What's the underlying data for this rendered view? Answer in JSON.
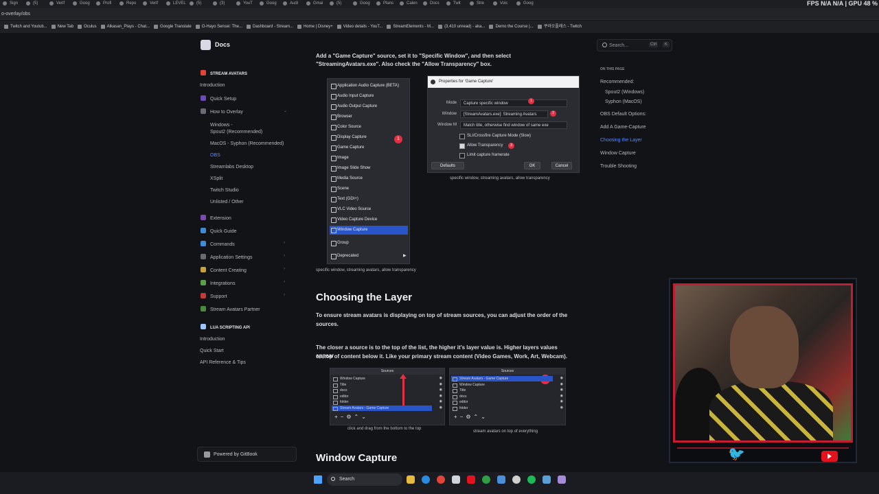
{
  "perf": "FPS N/A N/A | GPU 48 %",
  "browser": {
    "url": "o-overlay/obs",
    "tabs": [
      "Sign",
      "(5)",
      "Verif",
      "Goog",
      "Profi",
      "Repo",
      "Verif",
      "LEVEL",
      "(5)",
      "(3)",
      "YouT",
      "Goog",
      "Audi",
      "Gmai",
      "(5)",
      "Goog",
      "Plans",
      "Calen",
      "Docs",
      "Twit",
      "Stre",
      "Voic",
      "Goog"
    ],
    "bookmarks": [
      "Twitch and Youtub...",
      "New Tab",
      "Oculus",
      "Alkasan_Plays - Chat...",
      "Google Translate",
      "O-Hayo Sensei: The...",
      "Dashboard - Stream...",
      "Home | Disney+",
      "Video details - YouT...",
      "StreamElements - M...",
      "(3,410 unread) - aka...",
      "Demo the Course |...",
      "쿠라오플래스 - Twitch"
    ]
  },
  "header": {
    "title": "Docs",
    "search_placeholder": "Search...",
    "shortcut_ctrl": "Ctrl",
    "shortcut_k": "K"
  },
  "sidebar": {
    "section1": "STREAM AVATARS",
    "introduction": "Introduction",
    "quick_setup": "Quick Setup",
    "how_to_overlay": "How to Overlay",
    "spout_1": "Windows -",
    "spout_2": "Spout2 (Recommended)",
    "macos": "MacOS - Syphon (Recommended)",
    "obs": "OBS",
    "streamlabs": "Streamlabs Desktop",
    "xsplit": "XSplit",
    "twitch_studio": "Twitch Studio",
    "unlisted": "Unlisted / Other",
    "extension": "Extension",
    "quick_guide": "Quick Guide",
    "commands": "Commands",
    "app_settings": "Application Settings",
    "content_creating": "Content Creating",
    "integrations": "Integrations",
    "support": "Support",
    "partner": "Stream Avatars Partner",
    "section2": "LUA SCRIPTING API",
    "lua_intro": "Introduction",
    "lua_quick": "Quick Start",
    "lua_ref": "API Reference & Tips",
    "gitbook": "Powered by GitBook"
  },
  "content": {
    "intro_line1": "Add a \"Game Capture\" source, set it to \"Specific Window\", and then select",
    "intro_line2": "\"StreamingAvatars.exe\". Also check the \"Allow Transparency\" box.",
    "menu_items": [
      "Application Audio Capture (BETA)",
      "Audio Input Capture",
      "Audio Output Capture",
      "Browser",
      "Color Source",
      "Display Capture",
      "Game Capture",
      "Image",
      "Image Slide Show",
      "Media Source",
      "Scene",
      "Text (GDI+)",
      "VLC Video Source",
      "Video Capture Device",
      "Window Capture",
      "Group",
      "Deprecated"
    ],
    "menu_marker": "1",
    "menu_caption": "specific window, streaming avatars, allow transparency",
    "props_title": "Properties for 'Game Capture'",
    "props_mode_label": "Mode",
    "props_mode_value": "Capture specific window",
    "props_window_label": "Window",
    "props_window_value": "[StreamAvatars.exe]: Streaming Avatars",
    "props_match_label": "Window M",
    "props_match_value": "Match title, otherwise find window of same exe",
    "props_sli": "SLI/Crossfire Capture Mode (Slow)",
    "props_transparency": "Allow Transparency",
    "props_limit": "Limit capture framerate",
    "props_defaults": "Defaults",
    "props_ok": "OK",
    "props_cancel": "Cancel",
    "badge1": "1",
    "badge2": "2",
    "badge3": "3",
    "props_caption": "specific window, streaming avatars, allow transparency",
    "h_layer": "Choosing the Layer",
    "layer_p1_l1": "To ensure stream avatars is displaying on top of stream sources, you can adjust the order of the",
    "layer_p1_l2": "sources.",
    "layer_p2_l1": "The closer a source is to the top of the list, the higher it's layer value is. Higher layers values appear",
    "layer_p2_l2": "on top of content below it. Like your primary stream content (Video Games, Work, Art, Webcam).",
    "sources_header": "Sources",
    "left_sources": [
      "Window Capture",
      "Title",
      "docs",
      "editor",
      "folder",
      "Stream Avatars - Game Capture"
    ],
    "right_sources": [
      "Stream Avatars - Game Capture",
      "Window Capture",
      "Title",
      "docs",
      "editor",
      "folder"
    ],
    "right_badge": "1",
    "left_caption": "click and drag from the bottom to the top",
    "right_caption": "stream avatars on top of everything",
    "h_window": "Window Capture"
  },
  "toc": {
    "heading": "ON THIS PAGE",
    "items": [
      "Recommended:",
      "Spout2 (Windows)",
      "Syphon (MacOS)",
      "OBS Default Options:",
      "Add A Game-Capture",
      "Choosing the Layer",
      "Window Capture",
      "Trouble Shooting"
    ]
  },
  "taskbar": {
    "search": "Search"
  },
  "colors": {
    "accent": "#5b8bff",
    "selection": "#2a55c9",
    "marker": "#e23143",
    "background": "#121316"
  }
}
